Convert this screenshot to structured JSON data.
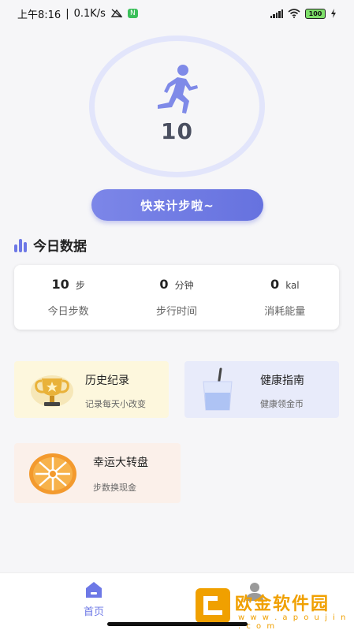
{
  "status_bar": {
    "time": "上午8:16",
    "net_speed": "0.1K/s",
    "nfc": "N",
    "battery": "100"
  },
  "tracker": {
    "steps": "10",
    "start_label": "快来计步啦~"
  },
  "today": {
    "title": "今日数据",
    "stats": [
      {
        "value": "10",
        "unit": "步",
        "label": "今日步数"
      },
      {
        "value": "0",
        "unit": "分钟",
        "label": "步行时间"
      },
      {
        "value": "0",
        "unit": "kal",
        "label": "消耗能量"
      }
    ]
  },
  "cards": {
    "history": {
      "title": "历史纪录",
      "sub": "记录每天小改变"
    },
    "health": {
      "title": "健康指南",
      "sub": "健康领金币"
    },
    "lucky": {
      "title": "幸运大转盘",
      "sub": "步数换现金"
    }
  },
  "nav": {
    "home": "首页"
  },
  "watermark": {
    "name": "欧金软件园",
    "url": "w w w . a p o u j i n . c o m"
  },
  "colors": {
    "accent": "#6d78e6",
    "ring": "#e2e5fb",
    "watermark": "#f0a000"
  }
}
